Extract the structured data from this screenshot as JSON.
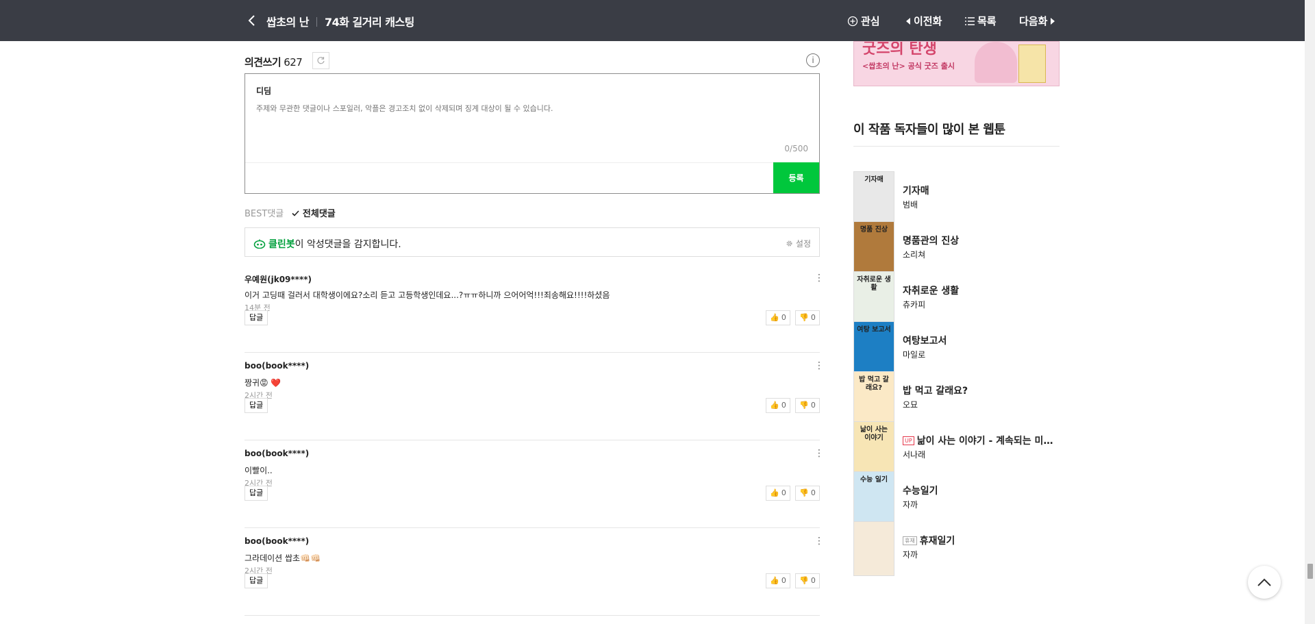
{
  "header": {
    "series_title": "쌉초의 난",
    "episode_title": "74화 길거리 캐스팅",
    "interest_label": "관심",
    "prev_label": "이전화",
    "list_label": "목록",
    "next_label": "다음화"
  },
  "comment_section": {
    "label": "의견쓰기",
    "count": "627",
    "info_icon_text": "i",
    "write": {
      "username": "디딤",
      "placeholder": "주제와 무관한 댓글이나 스포일러, 악플은 경고조치 없이 삭제되며 징계 대상이 될 수 있습니다.",
      "counter": "0/500",
      "submit_label": "등록"
    },
    "sort": {
      "best_label": "BEST댓글",
      "all_label": "전체댓글",
      "selected": "전체댓글"
    },
    "cleanbot": {
      "name": "클린봇",
      "text": "이 악성댓글을 감지합니다.",
      "setting_label": "설정"
    },
    "reply_label": "답글",
    "comments": [
      {
        "author": "우예원(jk09****)",
        "body": "이거 고딩때 걸러서 대학생이에요?소리 듣고 고등학생인데요...?ㅠㅠ하니까 으어어억!!!죄송해요!!!!하셨음",
        "time": "14분 전",
        "likes": "0",
        "dislikes": "0"
      },
      {
        "author": "boo(book****)",
        "body": "짱귀😡 ❤️",
        "time": "2시간 전",
        "likes": "0",
        "dislikes": "0"
      },
      {
        "author": "boo(book****)",
        "body": "이빨이..",
        "time": "2시간 전",
        "likes": "0",
        "dislikes": "0"
      },
      {
        "author": "boo(book****)",
        "body": "그라데이션 쌉초👊🏻👊🏻",
        "time": "2시간 전",
        "likes": "0",
        "dislikes": "0"
      }
    ]
  },
  "sidebar": {
    "banner": {
      "headline": "굿즈의 탄생",
      "subtitle": "<쌉초의 난> 공식 굿즈 출시"
    },
    "recommend_title": "이 작품 독자들이 많이 본 웹툰",
    "items": [
      {
        "title": "기자매",
        "author": "범배",
        "badge": "",
        "thumb_color": "#e8e8e8",
        "thumb_text": "기자매"
      },
      {
        "title": "명품관의 진상",
        "author": "소리쳐",
        "badge": "",
        "thumb_color": "#b07a3c",
        "thumb_text": "명품 진상"
      },
      {
        "title": "자취로운 생활",
        "author": "츄카피",
        "badge": "",
        "thumb_color": "#e9efe6",
        "thumb_text": "자취로운 생활"
      },
      {
        "title": "여탕보고서",
        "author": "마일로",
        "badge": "",
        "thumb_color": "#1d7fc4",
        "thumb_text": "여탕 보고서"
      },
      {
        "title": "밥 먹고 갈래요?",
        "author": "오묘",
        "badge": "",
        "thumb_color": "#fbe9c6",
        "thumb_text": "밥 먹고 갈래요?"
      },
      {
        "title": "낢이 사는 이야기 - 계속되는 미미...",
        "author": "서나래",
        "badge": "UP",
        "thumb_color": "#f7e5b5",
        "thumb_text": "낢이 사는 이야기"
      },
      {
        "title": "수능일기",
        "author": "자까",
        "badge": "",
        "thumb_color": "#cfe6f2",
        "thumb_text": "수능 일기"
      },
      {
        "title": "휴재일기",
        "author": "자까",
        "badge": "휴재",
        "thumb_color": "#f5ead9",
        "thumb_text": ""
      }
    ]
  }
}
